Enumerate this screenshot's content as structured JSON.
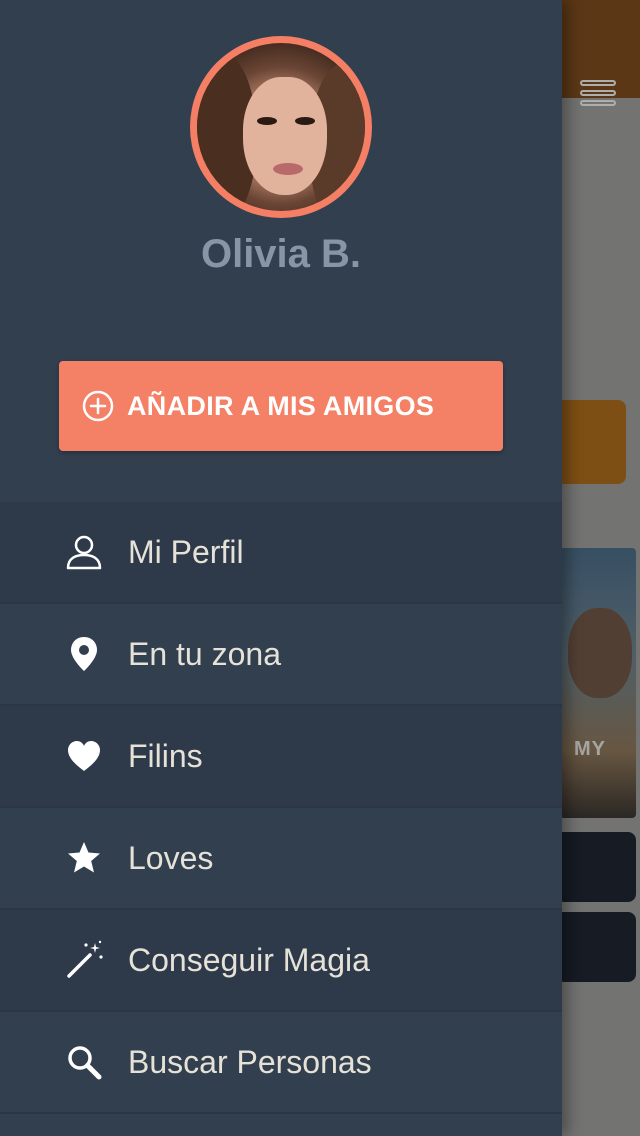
{
  "drawer": {
    "profile": {
      "name": "Olivia B.",
      "avatar": "profile-photo"
    },
    "add_friend_button": {
      "icon": "plus-circle-icon",
      "label": "AÑADIR A MIS AMIGOS"
    },
    "menu": [
      {
        "icon": "user-icon",
        "label": "Mi Perfil"
      },
      {
        "icon": "map-pin-icon",
        "label": "En tu zona"
      },
      {
        "icon": "heart-icon",
        "label": "Filins"
      },
      {
        "icon": "star-icon",
        "label": "Loves"
      },
      {
        "icon": "magic-wand-icon",
        "label": "Conseguir Magia"
      },
      {
        "icon": "search-icon",
        "label": "Buscar Personas"
      }
    ]
  },
  "background_app": {
    "menu_icon": "hamburger-menu-icon",
    "photo_overlay_text": "MY"
  },
  "colors": {
    "drawer_bg": "#323f4f",
    "accent": "#f48066",
    "name_text": "#8796a6",
    "menu_text": "#e6e2d8"
  }
}
